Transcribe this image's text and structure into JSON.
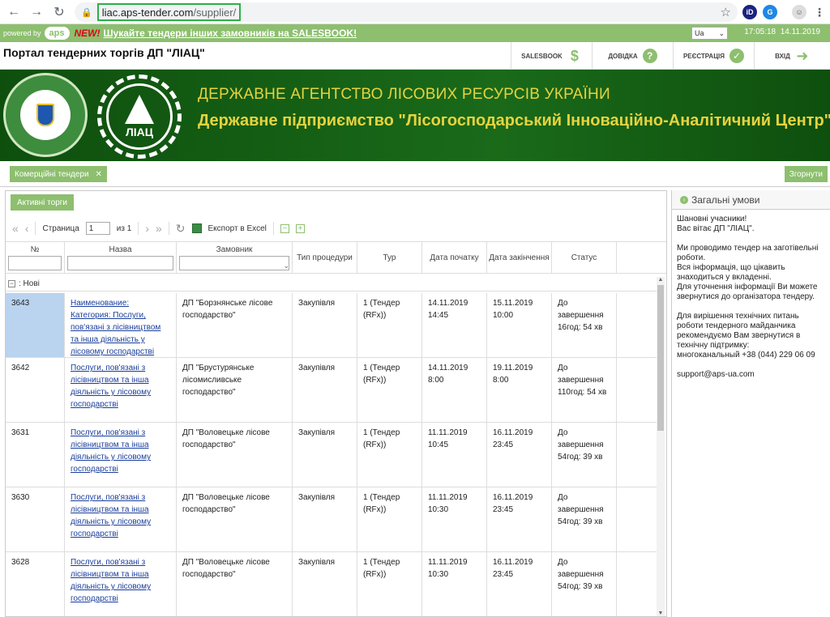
{
  "browser": {
    "url_host": "liac.aps-tender.com",
    "url_path": "/supplier/",
    "ext1": "iD",
    "ext2": "G"
  },
  "topbar": {
    "powered": "powered by",
    "logo": "aps",
    "new_label": "NEW!",
    "promo": "Шукайте тендери інших замовників на SALESBOOK!",
    "lang": "Ua",
    "time": "17:05:18",
    "date": "14.11.2019"
  },
  "portal": {
    "title": "Портал тендерних торгів ДП \"ЛІАЦ\"",
    "buttons": {
      "salesbook": "SALESBOOK",
      "help": "ДОВІДКА",
      "register": "РЕЄСТРАЦІЯ",
      "login": "ВХІД"
    }
  },
  "banner": {
    "line1": "ДЕРЖАВНЕ АГЕНТСТВО ЛІСОВИХ РЕСУРСІВ УКРАЇНИ",
    "line2": "Державне підприємство \"Лісогосподарський Інноваційно-Аналітичний Центр\"",
    "logo_label": "ЛІАЦ"
  },
  "tabs": {
    "commercial": "Комерційні тендери",
    "collapse": "Згорнути"
  },
  "toolbar": {
    "active": "Активні торги",
    "page_label": "Страница",
    "page_value": "1",
    "of_label": "из 1",
    "export": "Експорт в Excel"
  },
  "table": {
    "headers": {
      "num": "№",
      "name": "Назва",
      "customer": "Замовник",
      "type": "Тип процедури",
      "tour": "Тур",
      "start": "Дата початку",
      "end": "Дата закінчення",
      "status": "Статус"
    },
    "group_label": ": Нові",
    "rows": [
      {
        "num": "3643",
        "name": "Наименование: Категория: Послуги, пов'язані з лісівництвом та інша діяльність у лісовому господарстві",
        "customer": "ДП \"Борзнянське лісове господарство\"",
        "type": "Закупівля",
        "tour": "1 (Тендер (RFx))",
        "start": "14.11.2019 14:45",
        "end": "15.11.2019 10:00",
        "status": "До завершення 16год: 54 хв"
      },
      {
        "num": "3642",
        "name": "Послуги, пов'язані з лісівництвом та інша діяльність у лісовому господарстві",
        "customer": "ДП \"Брустурянське лісомисливське господарство\"",
        "type": "Закупівля",
        "tour": "1 (Тендер (RFx))",
        "start": "14.11.2019 8:00",
        "end": "19.11.2019 8:00",
        "status": "До завершення 110год: 54 хв"
      },
      {
        "num": "3631",
        "name": "Послуги, пов'язані з лісівництвом та інша діяльність у лісовому господарстві",
        "customer": "ДП \"Воловецьке лісове господарство\"",
        "type": "Закупівля",
        "tour": "1 (Тендер (RFx))",
        "start": "11.11.2019 10:45",
        "end": "16.11.2019 23:45",
        "status": "До завершення 54год: 39 хв"
      },
      {
        "num": "3630",
        "name": "Послуги, пов'язані з лісівництвом та інша діяльність у лісовому господарстві",
        "customer": "ДП \"Воловецьке лісове господарство\"",
        "type": "Закупівля",
        "tour": "1 (Тендер (RFx))",
        "start": "11.11.2019 10:30",
        "end": "16.11.2019 23:45",
        "status": "До завершення 54год: 39 хв"
      },
      {
        "num": "3628",
        "name": "Послуги, пов'язані з лісівництвом та інша діяльність у лісовому господарстві",
        "customer": "ДП \"Воловецьке лісове господарство\"",
        "type": "Закупівля",
        "tour": "1 (Тендер (RFx))",
        "start": "11.11.2019 10:30",
        "end": "16.11.2019 23:45",
        "status": "До завершення 54год: 39 хв"
      }
    ]
  },
  "conditions": {
    "title": "Загальні умови",
    "paragraphs": [
      "Шановні учасники!\nВас вітає ДП \"ЛІАЦ\".",
      "Ми проводимо тендер на заготівельні роботи.\nВся інформація, що цікавить знаходиться у вкладенні.\nДля уточнення інформації Ви можете звернутися до організатора тендеру.",
      "Для вирішення технічних питань роботи тендерного майданчика рекомендуємо Вам звернутися в технічну підтримку:\nмногоканальный +38 (044) 229 06 09",
      "support@aps-ua.com"
    ]
  }
}
